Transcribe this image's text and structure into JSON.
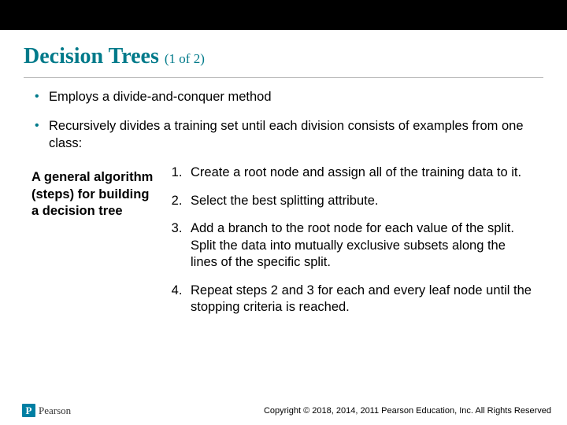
{
  "title_main": "Decision Trees",
  "title_sub": "(1 of 2)",
  "bullets": [
    "Employs a divide-and-conquer method",
    "Recursively divides a training set until each division consists of examples from one class:"
  ],
  "left_heading": "A general algorithm (steps) for building a decision tree",
  "steps": [
    "Create a root node and assign all of the training data to it.",
    "Select the best splitting attribute.",
    "Add a branch to the root node for each value of the split. Split the data into mutually exclusive subsets along the lines of the specific split.",
    "Repeat steps 2 and 3 for each and every leaf node until the stopping criteria is reached."
  ],
  "logo_letter": "P",
  "logo_name": "Pearson",
  "copyright": "Copyright © 2018, 2014, 2011 Pearson Education, Inc. All Rights Reserved"
}
